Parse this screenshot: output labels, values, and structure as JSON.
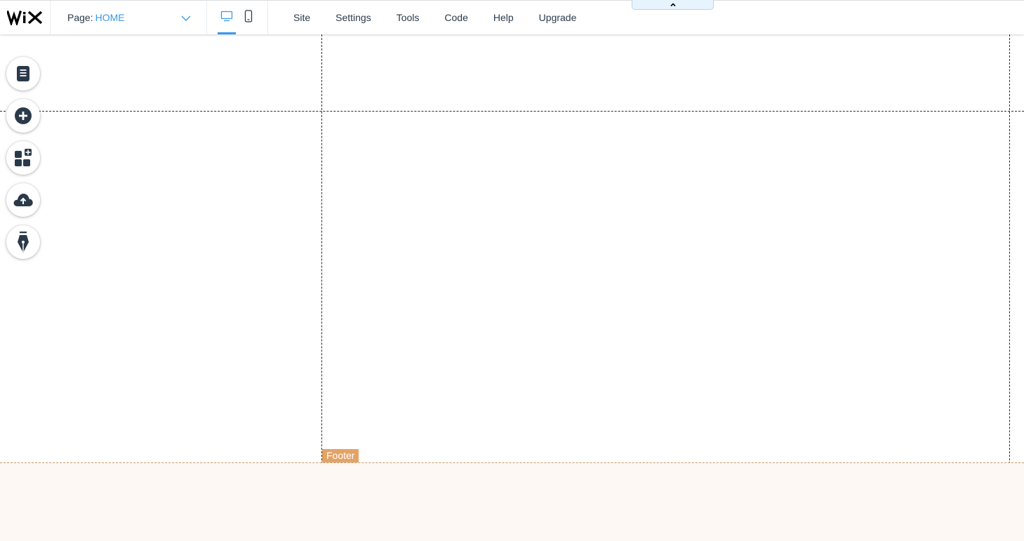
{
  "header": {
    "logo_text": "WIX",
    "page_selector": {
      "label": "Page:",
      "value": "HOME"
    },
    "devices": [
      "desktop",
      "mobile"
    ],
    "active_device": "desktop",
    "menu": [
      {
        "label": "Site"
      },
      {
        "label": "Settings"
      },
      {
        "label": "Tools"
      },
      {
        "label": "Code"
      },
      {
        "label": "Help"
      },
      {
        "label": "Upgrade"
      }
    ]
  },
  "left_toolbar": [
    {
      "name": "pages-menu",
      "icon": "pages-icon"
    },
    {
      "name": "add-elements",
      "icon": "plus-circle-icon"
    },
    {
      "name": "add-apps",
      "icon": "apps-add-icon"
    },
    {
      "name": "upload-media",
      "icon": "cloud-upload-icon"
    },
    {
      "name": "design",
      "icon": "pen-nib-icon"
    }
  ],
  "canvas": {
    "footer_label": "Footer"
  },
  "colors": {
    "accent": "#3899ec",
    "text": "#2b3a4a",
    "footer_tag": "#e3a366",
    "footer_bg": "#fdf8f3",
    "icon_dark": "#2b3a4a"
  }
}
